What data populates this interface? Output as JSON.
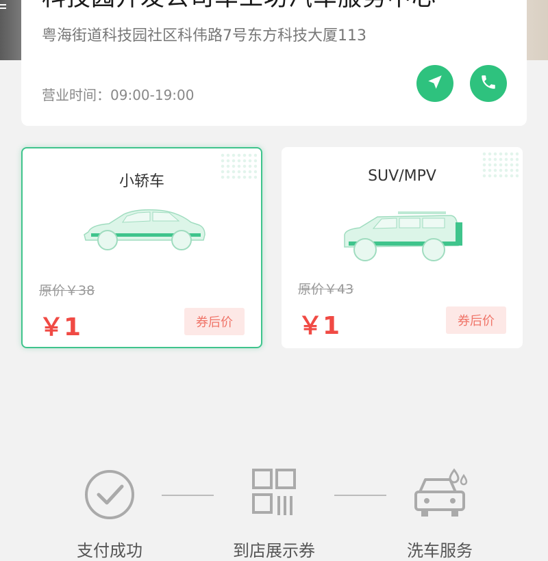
{
  "store": {
    "name": "科技园开发公司车工坊汽车服务中心",
    "address": "粤海街道科技园社区科伟路7号东方科技大厦113",
    "hours_label": "营业时间：",
    "hours_value": "09:00-19:00"
  },
  "vehicles": [
    {
      "name": "小轿车",
      "original_price": "原价￥38",
      "price": "￥1",
      "tag": "券后价",
      "selected": true
    },
    {
      "name": "SUV/MPV",
      "original_price": "原价￥43",
      "price": "￥1",
      "tag": "券后价",
      "selected": false
    }
  ],
  "steps": [
    {
      "label": "支付成功",
      "icon": "check-circle-icon"
    },
    {
      "label": "到店展示券",
      "icon": "qr-code-icon"
    },
    {
      "label": "洗车服务",
      "icon": "car-wash-icon"
    }
  ],
  "colors": {
    "accent": "#2ec27e",
    "price": "#f04a44",
    "tag_bg": "#fde8e6",
    "background": "#f2f2f2"
  }
}
